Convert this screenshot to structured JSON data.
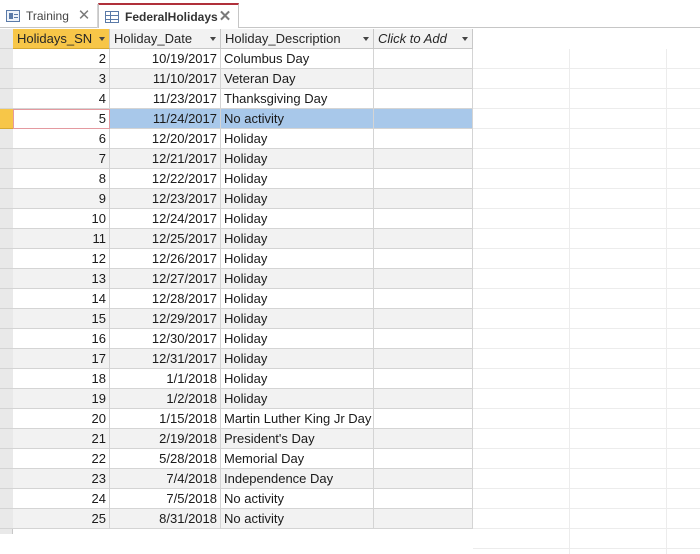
{
  "tabs": [
    {
      "label": "Training",
      "icon": "form-icon",
      "active": false
    },
    {
      "label": "FederalHolidays",
      "icon": "table-icon",
      "active": true
    }
  ],
  "columns": [
    {
      "label": "Holidays_SN"
    },
    {
      "label": "Holiday_Date"
    },
    {
      "label": "Holiday_Description"
    },
    {
      "label": "Click to Add"
    }
  ],
  "rows": [
    {
      "sn": "2",
      "date": "10/19/2017",
      "desc": "Columbus Day"
    },
    {
      "sn": "3",
      "date": "11/10/2017",
      "desc": "Veteran Day"
    },
    {
      "sn": "4",
      "date": "11/23/2017",
      "desc": "Thanksgiving Day"
    },
    {
      "sn": "5",
      "date": "11/24/2017",
      "desc": "No activity"
    },
    {
      "sn": "6",
      "date": "12/20/2017",
      "desc": "Holiday"
    },
    {
      "sn": "7",
      "date": "12/21/2017",
      "desc": "Holiday"
    },
    {
      "sn": "8",
      "date": "12/22/2017",
      "desc": "Holiday"
    },
    {
      "sn": "9",
      "date": "12/23/2017",
      "desc": "Holiday"
    },
    {
      "sn": "10",
      "date": "12/24/2017",
      "desc": "Holiday"
    },
    {
      "sn": "11",
      "date": "12/25/2017",
      "desc": "Holiday"
    },
    {
      "sn": "12",
      "date": "12/26/2017",
      "desc": "Holiday"
    },
    {
      "sn": "13",
      "date": "12/27/2017",
      "desc": "Holiday"
    },
    {
      "sn": "14",
      "date": "12/28/2017",
      "desc": "Holiday"
    },
    {
      "sn": "15",
      "date": "12/29/2017",
      "desc": "Holiday"
    },
    {
      "sn": "16",
      "date": "12/30/2017",
      "desc": "Holiday"
    },
    {
      "sn": "17",
      "date": "12/31/2017",
      "desc": "Holiday"
    },
    {
      "sn": "18",
      "date": "1/1/2018",
      "desc": "Holiday"
    },
    {
      "sn": "19",
      "date": "1/2/2018",
      "desc": "Holiday"
    },
    {
      "sn": "20",
      "date": "1/15/2018",
      "desc": "Martin Luther King Jr Day"
    },
    {
      "sn": "21",
      "date": "2/19/2018",
      "desc": "President's Day"
    },
    {
      "sn": "22",
      "date": "5/28/2018",
      "desc": "Memorial Day"
    },
    {
      "sn": "23",
      "date": "7/4/2018",
      "desc": "Independence Day"
    },
    {
      "sn": "24",
      "date": "7/5/2018",
      "desc": "No activity"
    },
    {
      "sn": "25",
      "date": "8/31/2018",
      "desc": "No activity"
    }
  ],
  "selected_row": 3,
  "colors": {
    "accent": "#b0303a",
    "current_row": "#f7c648",
    "selection": "#a8c8ea"
  }
}
